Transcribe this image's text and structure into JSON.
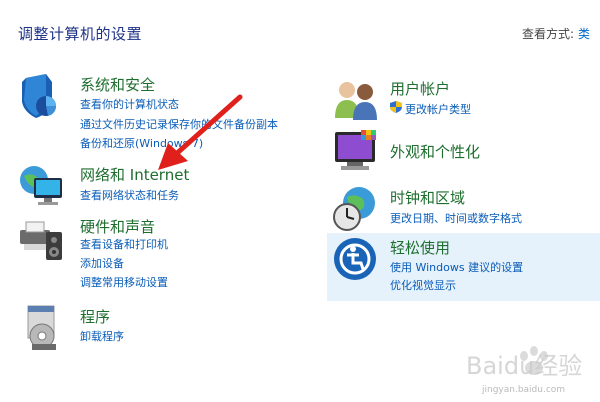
{
  "header": {
    "title": "调整计算机的设置",
    "view_by_label": "查看方式:",
    "view_by_value": "类"
  },
  "left": [
    {
      "heading": "系统和安全",
      "icon": "shield-icon",
      "links": [
        "查看你的计算机状态",
        "通过文件历史记录保存你的文件备份副本",
        "备份和还原(Windows 7)"
      ]
    },
    {
      "heading": "网络和 Internet",
      "icon": "globe-network-icon",
      "links": [
        "查看网络状态和任务"
      ]
    },
    {
      "heading": "硬件和声音",
      "icon": "printer-speaker-icon",
      "links": [
        "查看设备和打印机",
        "添加设备",
        "调整常用移动设置"
      ]
    },
    {
      "heading": "程序",
      "icon": "programs-disc-icon",
      "links": [
        "卸载程序"
      ]
    }
  ],
  "right": [
    {
      "heading": "用户帐户",
      "icon": "users-icon",
      "links": [
        "更改帐户类型"
      ]
    },
    {
      "heading": "外观和个性化",
      "icon": "monitor-palette-icon",
      "links": []
    },
    {
      "heading": "时钟和区域",
      "icon": "clock-globe-icon",
      "links": [
        "更改日期、时间或数字格式"
      ]
    },
    {
      "heading": "轻松使用",
      "icon": "ease-of-access-icon",
      "links": [
        "使用 Windows 建议的设置",
        "优化视觉显示"
      ]
    }
  ],
  "colors": {
    "heading": "#1e6e2e",
    "link": "#0a5cb8",
    "title": "#1e3287",
    "highlight": "#e5f1fb",
    "arrow": "#e0201b"
  },
  "watermark": {
    "text": "Baidu经验",
    "subtext": "jingyan.baidu.com"
  }
}
